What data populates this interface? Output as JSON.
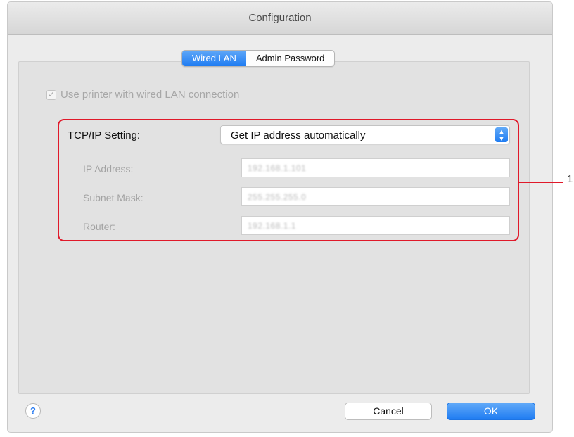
{
  "window": {
    "title": "Configuration"
  },
  "tabs": [
    {
      "label": "Wired LAN",
      "active": true
    },
    {
      "label": "Admin Password",
      "active": false
    }
  ],
  "wired_lan": {
    "use_wired_label": "Use printer with wired LAN connection",
    "use_wired_checked": true,
    "tcpip_label": "TCP/IP Setting:",
    "tcpip_value": "Get IP address automatically",
    "fields": [
      {
        "label": "IP Address:",
        "value": "192.168.1.101"
      },
      {
        "label": "Subnet Mask:",
        "value": "255.255.255.0"
      },
      {
        "label": "Router:",
        "value": "192.168.1.1"
      }
    ]
  },
  "callout": {
    "number": "1"
  },
  "buttons": {
    "help": "?",
    "cancel": "Cancel",
    "ok": "OK"
  },
  "colors": {
    "accent": "#1f7cf2",
    "highlight": "#e0192a"
  }
}
